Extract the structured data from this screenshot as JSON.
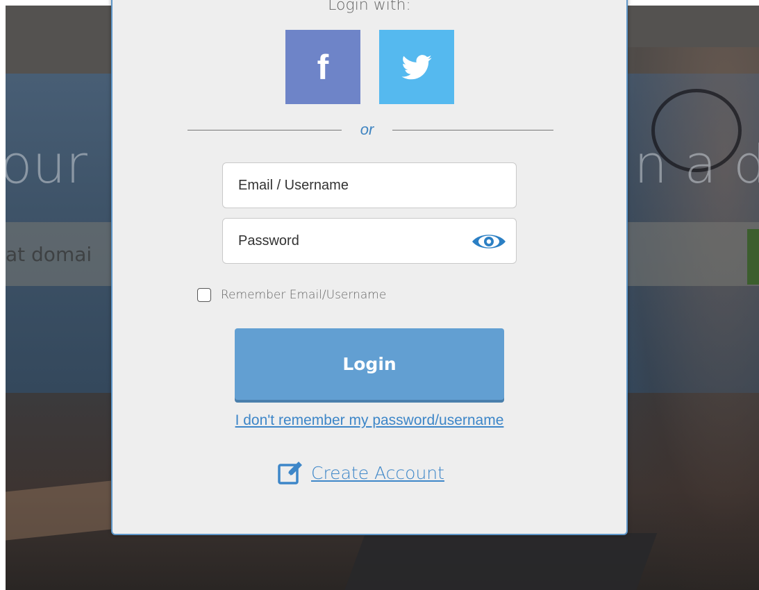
{
  "modal": {
    "heading": "Login with:",
    "facebook_label": "f",
    "or_label": "or",
    "email_placeholder": "Email / Username",
    "password_placeholder": "Password",
    "remember_label": "Remember Email/Username",
    "login_button": "Login",
    "forgot_link": "I don't remember my password/username",
    "create_account_link": "Create Account"
  },
  "background": {
    "headline_left": "our",
    "headline_right": "n a do",
    "search_placeholder": "at domai"
  },
  "colors": {
    "facebook": "#6e84c8",
    "twitter": "#55b9ef",
    "accent": "#3f84c1",
    "login_button": "#629fd2",
    "modal_border": "#5f97c9"
  },
  "icons": [
    "facebook-icon",
    "twitter-icon",
    "eye-icon",
    "edit-icon"
  ]
}
